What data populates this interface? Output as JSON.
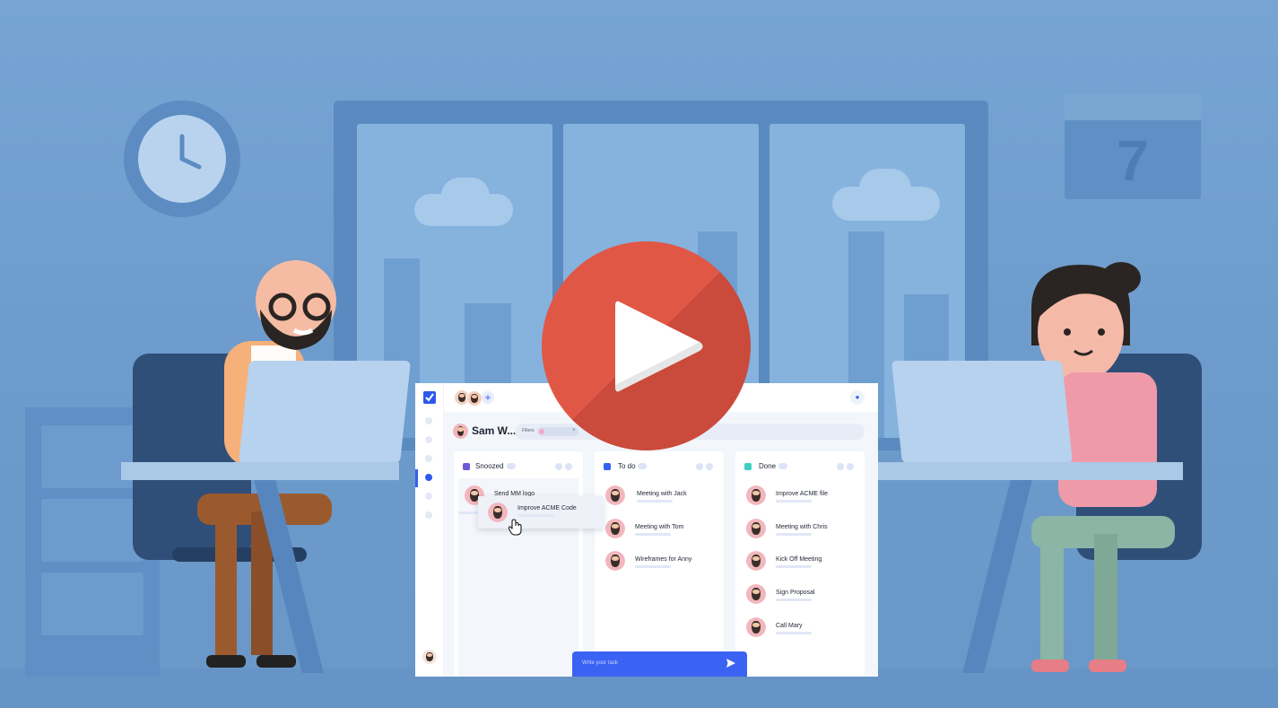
{
  "scene": {
    "calendar_day": "7"
  },
  "app": {
    "user_name": "Sam W...",
    "filters_label": "Filters",
    "columns": [
      {
        "title": "Snoozed",
        "color": "#6e58d8",
        "cards": [
          {
            "title": "Send MM logo"
          }
        ]
      },
      {
        "title": "To do",
        "color": "#3560f2",
        "cards": [
          {
            "title": "Meeting with Jack"
          },
          {
            "title": "Meeting with Tom"
          },
          {
            "title": "Wireframes for Anny"
          }
        ]
      },
      {
        "title": "Done",
        "color": "#3ccfc0",
        "cards": [
          {
            "title": "Improve ACME file"
          },
          {
            "title": "Meeting with Chris"
          },
          {
            "title": "Kick Off Meeting"
          },
          {
            "title": "Sign Proposal"
          },
          {
            "title": "Call Mary"
          }
        ]
      }
    ],
    "dragging_card": {
      "title": "Improve ACME Code"
    },
    "task_input": {
      "placeholder": "Write your task"
    },
    "accent_color": "#3a63f4"
  },
  "icons": {
    "play": "play-icon",
    "logo": "checkmark-logo-icon",
    "send": "send-icon",
    "cursor": "hand-cursor-icon",
    "plus": "plus-icon"
  }
}
